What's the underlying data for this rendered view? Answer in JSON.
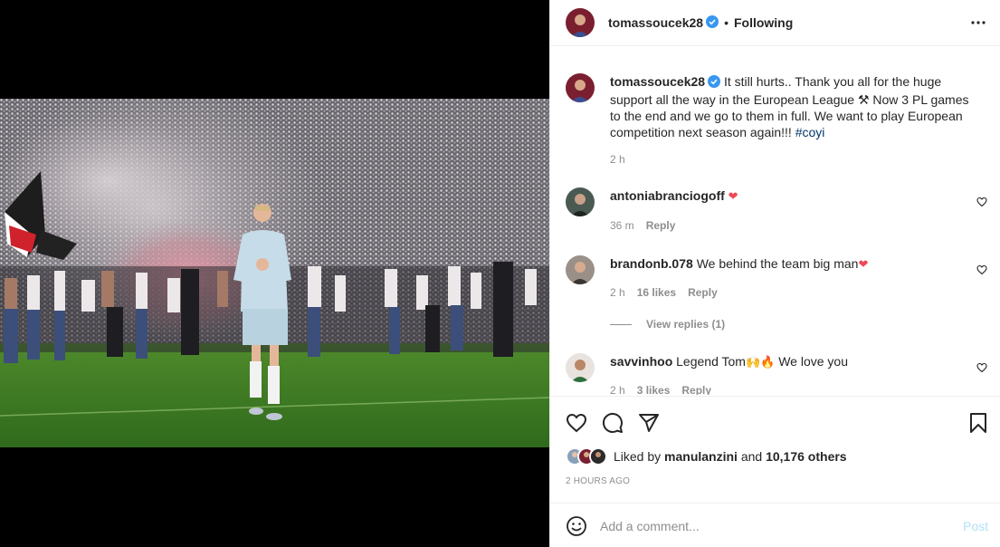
{
  "post": {
    "author": "tomassoucek28",
    "follow_state": "Following",
    "separator": "•",
    "caption": {
      "text": "It still hurts.. Thank you all for the huge support all the way in the European League ⚒ Now 3 PL games to the end and we go to them in full. We want to play European competition next season again!!! ",
      "hashtag": "#coyi",
      "time": "2 h"
    }
  },
  "comments": [
    {
      "user": "antoniabranciogoff",
      "text": "",
      "emoji": "❤",
      "time": "36 m",
      "likes": "",
      "reply": "Reply"
    },
    {
      "user": "brandonb.078",
      "text": "We behind the team big man",
      "emoji": "❤",
      "time": "2 h",
      "likes": "16 likes",
      "reply": "Reply",
      "view_replies": "View replies (1)"
    },
    {
      "user": "savvinhoo",
      "text": "Legend Tom",
      "emoji": "🙌🔥",
      "text2": " We love you",
      "time": "2 h",
      "likes": "3 likes",
      "reply": "Reply"
    }
  ],
  "likes": {
    "prefix": "Liked by ",
    "user": "manulanzini",
    "middle": " and ",
    "count": "10,176 others"
  },
  "timestamp": "2 HOURS AGO",
  "comment_box": {
    "placeholder": "Add a comment...",
    "post_label": "Post"
  },
  "icons": {
    "like": "heart-icon",
    "comment": "comment-icon",
    "share": "share-icon",
    "save": "bookmark-icon",
    "more": "more-options-icon",
    "emoji": "emoji-icon",
    "verified": "verified-badge-icon"
  },
  "colors": {
    "link": "#00376b",
    "muted": "#8e8e8e",
    "verified": "#3897f0",
    "heart": "#ed4956",
    "post_disabled": "#b2dffc"
  }
}
